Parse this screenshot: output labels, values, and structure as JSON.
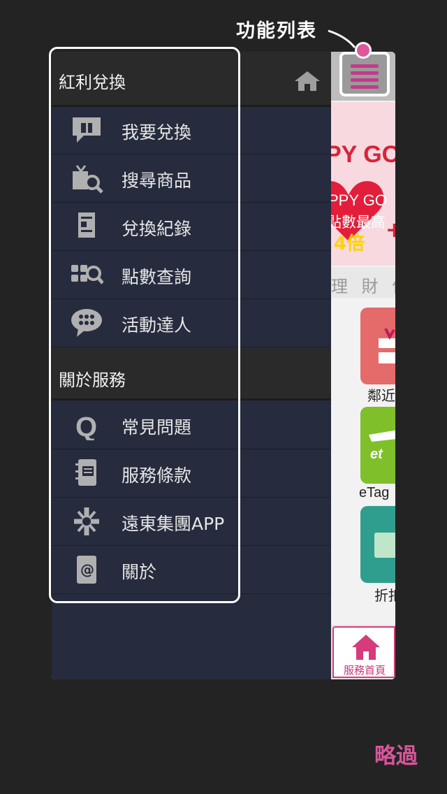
{
  "tutorial": {
    "callout": "功能列表",
    "skip_label": "略過",
    "highlight_color": "#e0569a"
  },
  "app_preview": {
    "banner_big": "PY GO",
    "banner_sub1": "PPY GO",
    "banner_sub2": "點數最高",
    "banner_sub3": "4倍",
    "banner_plus": "+",
    "tabs_text": "理 財 信",
    "tile_labels": [
      "鄰近",
      "eTag",
      "折扣"
    ],
    "home_tab_label": "服務首頁"
  },
  "menu": {
    "sections": [
      {
        "title": "紅利兌換",
        "items": [
          {
            "label": "我要兌換",
            "icon": "gift-bubble-icon"
          },
          {
            "label": "搜尋商品",
            "icon": "gift-search-icon"
          },
          {
            "label": "兌換紀錄",
            "icon": "document-icon"
          },
          {
            "label": "點數查詢",
            "icon": "points-search-icon"
          },
          {
            "label": "活動達人",
            "icon": "chat-grid-icon"
          }
        ]
      },
      {
        "title": "關於服務",
        "items": [
          {
            "label": "常見問題",
            "icon": "faq-q-icon"
          },
          {
            "label": "服務條款",
            "icon": "notebook-icon"
          },
          {
            "label": "遠東集團APP",
            "icon": "group-logo-icon"
          },
          {
            "label": "關於",
            "icon": "at-notebook-icon"
          }
        ]
      }
    ]
  }
}
